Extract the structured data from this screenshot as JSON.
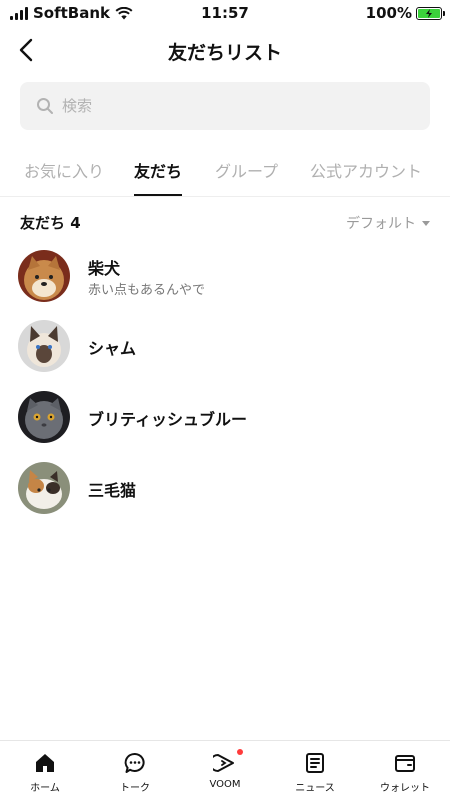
{
  "status_bar": {
    "carrier": "SoftBank",
    "time": "11:57",
    "battery": "100%"
  },
  "header": {
    "title": "友だちリスト"
  },
  "search": {
    "placeholder": "検索"
  },
  "tabs": [
    {
      "label": "お気に入り",
      "active": false
    },
    {
      "label": "友だち",
      "active": true
    },
    {
      "label": "グループ",
      "active": false
    },
    {
      "label": "公式アカウント",
      "active": false
    }
  ],
  "section": {
    "title": "友だち 4",
    "sort_label": "デフォルト"
  },
  "friends": [
    {
      "name": "柴犬",
      "status": "赤い点もあるんやで",
      "avatar": "shiba-dog-photo"
    },
    {
      "name": "シャム",
      "status": "",
      "avatar": "siamese-cat-photo"
    },
    {
      "name": "ブリティッシュブルー",
      "status": "",
      "avatar": "british-blue-cat-photo"
    },
    {
      "name": "三毛猫",
      "status": "",
      "avatar": "calico-cat-photo"
    }
  ],
  "bottom_nav": [
    {
      "label": "ホーム",
      "icon": "home-icon"
    },
    {
      "label": "トーク",
      "icon": "chat-icon"
    },
    {
      "label": "VOOM",
      "icon": "voom-icon"
    },
    {
      "label": "ニュース",
      "icon": "news-icon"
    },
    {
      "label": "ウォレット",
      "icon": "wallet-icon"
    }
  ],
  "colors": {
    "notification_dot": "#ff3b3b",
    "battery_fill": "#3bd13b"
  }
}
